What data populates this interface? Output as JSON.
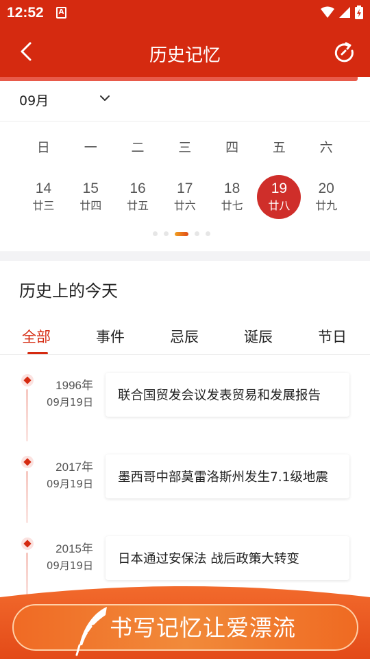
{
  "status_bar": {
    "time": "12:52",
    "notification_icon": "A"
  },
  "header": {
    "title": "历史记忆",
    "back_icon": "chevron-left-icon",
    "refresh_icon": "refresh-icon"
  },
  "month_selector": {
    "value": "09月"
  },
  "calendar": {
    "weekdays": [
      "日",
      "一",
      "二",
      "三",
      "四",
      "五",
      "六"
    ],
    "days": [
      {
        "num": "14",
        "lunar": "廿三"
      },
      {
        "num": "15",
        "lunar": "廿四"
      },
      {
        "num": "16",
        "lunar": "廿五"
      },
      {
        "num": "17",
        "lunar": "廿六"
      },
      {
        "num": "18",
        "lunar": "廿七"
      },
      {
        "num": "19",
        "lunar": "廿八",
        "selected": true
      },
      {
        "num": "20",
        "lunar": "廿九"
      }
    ],
    "page_index": 3,
    "page_count": 5
  },
  "section": {
    "title": "历史上的今天"
  },
  "tabs": [
    "全部",
    "事件",
    "忌辰",
    "诞辰",
    "节日"
  ],
  "active_tab": 0,
  "events": [
    {
      "year": "1996年",
      "date": "09月19日",
      "title": "联合国贸发会议发表贸易和发展报告"
    },
    {
      "year": "2017年",
      "date": "09月19日",
      "title": "墨西哥中部莫雷洛斯州发生7.1级地震"
    },
    {
      "year": "2015年",
      "date": "09月19日",
      "title": "日本通过安保法 战后政策大转变"
    }
  ],
  "banner": {
    "label": "书写记忆让爱漂流"
  },
  "colors": {
    "primary": "#d52a10",
    "selected_day": "#cf2e2a",
    "banner": "#f06a24"
  }
}
